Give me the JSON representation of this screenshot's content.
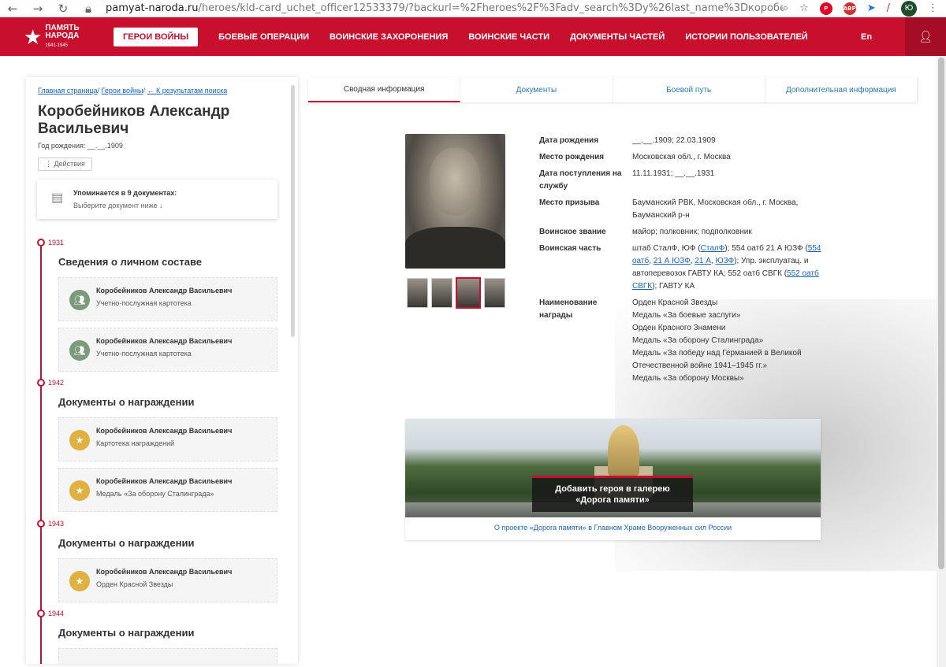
{
  "browser": {
    "url_host": "pamyat-naroda.ru",
    "url_path": "/heroes/kld-card_uchet_officer12533379/?backurl=%2Fheroes%2F%3Fadv_search%3Dy%26last_name%3Dкоробейников%26gr...",
    "account_initial": "Ю"
  },
  "header": {
    "logo_line1": "ПАМЯТЬ",
    "logo_line2": "НАРОДА",
    "logo_years": "1941-1945",
    "nav": [
      "ГЕРОИ ВОЙНЫ",
      "БОЕВЫЕ ОПЕРАЦИИ",
      "ВОИНСКИЕ ЗАХОРОНЕНИЯ",
      "ВОИНСКИЕ ЧАСТИ",
      "ДОКУМЕНТЫ ЧАСТЕЙ",
      "ИСТОРИИ ПОЛЬЗОВАТЕЛЕЙ"
    ],
    "lang": "En"
  },
  "sidebar": {
    "breadcrumb": [
      "Главная страница",
      "Герои войны",
      "← К результатам поиска"
    ],
    "name": "Коробейников Александр Васильевич",
    "birth_year": "Год рождения: __.__.1909",
    "actions": "⋮ Действия",
    "mentions_title": "Упоминается в 9 документах:",
    "mentions_sub": "Выберите документ ниже ↓",
    "timeline": [
      {
        "year": "1931",
        "section": "Сведения о личном составе",
        "cards": [
          {
            "name": "Коробейников Александр Васильевич",
            "desc": "Учетно-послужная картотека"
          },
          {
            "name": "Коробейников Александр Васильевич",
            "desc": "Учетно-послужная картотека"
          }
        ]
      },
      {
        "year": "1942",
        "section": "Документы о награждении",
        "cards": [
          {
            "name": "Коробейников Александр Васильевич",
            "desc": "Картотека награждений"
          },
          {
            "name": "Коробейников Александр Васильевич",
            "desc": "Медаль «За оборону Сталинграда»"
          }
        ]
      },
      {
        "year": "1943",
        "section": "Документы о награждении",
        "cards": [
          {
            "name": "Коробейников Александр Васильевич",
            "desc": "Орден Красной Звезды"
          }
        ]
      },
      {
        "year": "1944",
        "section": "Документы о награждении",
        "cards": []
      }
    ]
  },
  "tabs": [
    "Сводная информация",
    "Документы",
    "Боевой путь",
    "Дополнительная информация"
  ],
  "info": {
    "birth_date_label": "Дата рождения",
    "birth_date": "__.__.1909; 22.03.1909",
    "birth_place_label": "Место рождения",
    "birth_place": "Московская обл., г. Москва",
    "service_date_label": "Дата поступления на службу",
    "service_date": "11.11.1931; __.__.1931",
    "draft_place_label": "Место призыва",
    "draft_place": "Бауманский РВК, Московская обл., г. Москва, Бауманский р-н",
    "rank_label": "Воинское звание",
    "rank": "майор; полковник; подполковник",
    "unit_label": "Воинская часть",
    "unit_t1": "штаб СталФ, ЮФ (",
    "unit_l1": "СталФ",
    "unit_t2": "); 554 оатб 21 А ЮЗФ (",
    "unit_l2": "554 оатб",
    "unit_t3": ", ",
    "unit_l3": "21 А ЮЗФ",
    "unit_t4": ", ",
    "unit_l4": "21 А",
    "unit_t5": ", ",
    "unit_l5": "ЮЗФ",
    "unit_t6": "); Упр. эксплуатац. и автоперевозок ГАВТУ КА; 552 оатб СВГК (",
    "unit_l6": "552 оатб СВГК",
    "unit_t7": "); ГАВТУ КА",
    "awards_label": "Наименование награды",
    "awards": [
      "Орден Красной Звезды",
      "Медаль «За боевые заслуги»",
      "Орден Красного Знамени",
      "Медаль «За оборону Сталинграда»",
      "Медаль «За победу над Германией в Великой Отечественной войне 1941–1945 гг.»",
      "Медаль «За оборону Москвы»"
    ]
  },
  "banner": {
    "button_line1": "Добавить героя в галерею",
    "button_line2": "«Дорога памяти»",
    "link": "О проекте «Дорога памяти» в Главном Храме Вооруженных сил России"
  },
  "colors": {
    "brand_red": "#c8102e",
    "link_blue": "#1565c0"
  }
}
